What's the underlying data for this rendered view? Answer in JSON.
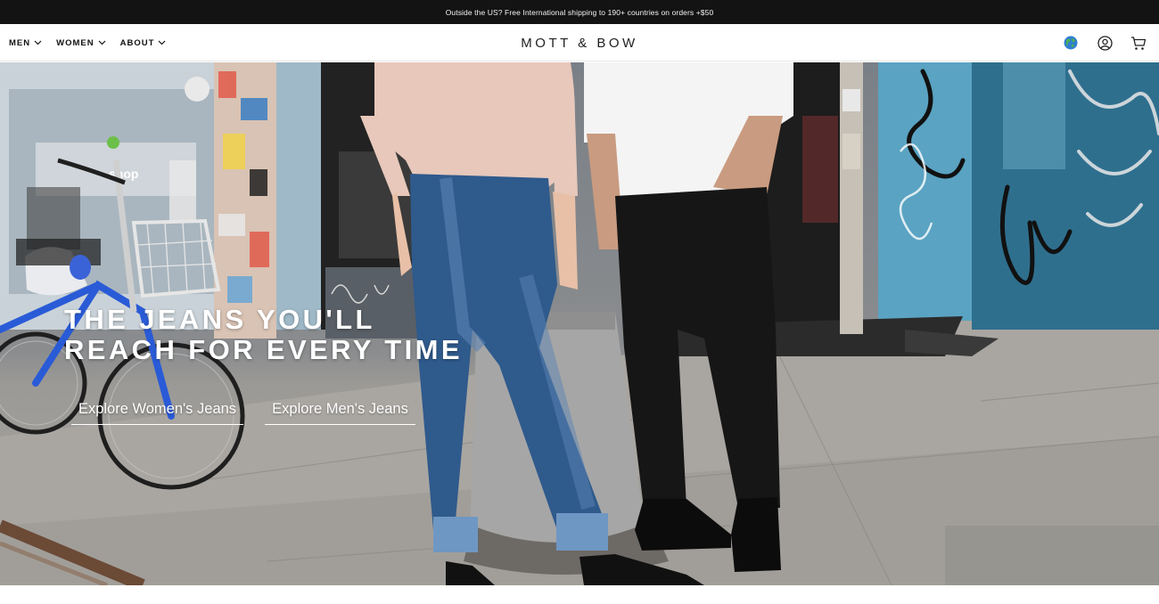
{
  "announcement": {
    "text": "Outside the US? Free International shipping to 190+ countries on orders +$50"
  },
  "header": {
    "nav": [
      {
        "label": "MEN"
      },
      {
        "label": "WOMEN"
      },
      {
        "label": "ABOUT"
      }
    ],
    "logo": "MOTT & BOW",
    "icons": [
      "globe-icon",
      "account-icon",
      "cart-icon"
    ]
  },
  "hero": {
    "title_line1": "THE JEANS YOU'LL",
    "title_line2": "REACH FOR EVERY TIME",
    "cta_women": "Explore Women's Jeans",
    "cta_men": "Explore Men's Jeans",
    "storefront_sign": "shop"
  },
  "colors": {
    "announcement_bg": "#131313",
    "header_bg": "#ffffff",
    "hero_text": "#ffffff",
    "wall_blue": "#3f8aa8",
    "denim_blue": "#2f5a8c",
    "sweater_pink": "#e7c8bb"
  }
}
